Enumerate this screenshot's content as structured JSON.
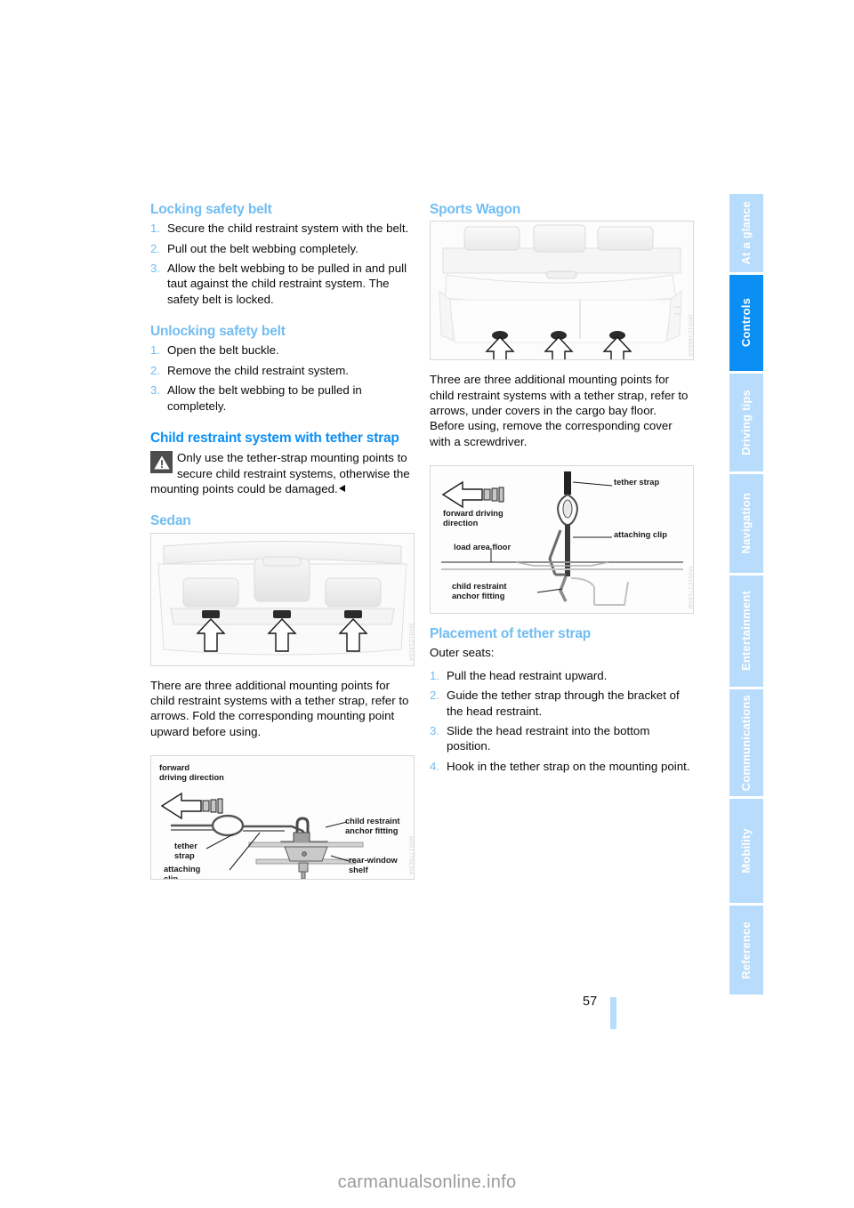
{
  "document": {
    "page_number": "57",
    "watermark": "carmanualsonline.info"
  },
  "nav_rail": {
    "items": [
      {
        "label": "At a glance",
        "active": false
      },
      {
        "label": "Controls",
        "active": true
      },
      {
        "label": "Driving tips",
        "active": false
      },
      {
        "label": "Navigation",
        "active": false
      },
      {
        "label": "Entertainment",
        "active": false
      },
      {
        "label": "Communications",
        "active": false
      },
      {
        "label": "Mobility",
        "active": false
      },
      {
        "label": "Reference",
        "active": false
      }
    ],
    "active_color": "#0c8ff5",
    "inactive_color": "#b8dcfb"
  },
  "left_column": {
    "locking": {
      "heading": "Locking safety belt",
      "steps": [
        {
          "num": "1.",
          "text": "Secure the child restraint system with the belt."
        },
        {
          "num": "2.",
          "text": "Pull out the belt webbing completely."
        },
        {
          "num": "3.",
          "text": "Allow the belt webbing to be pulled in and pull taut against the child restraint system. The safety belt is locked."
        }
      ]
    },
    "unlocking": {
      "heading": "Unlocking safety belt",
      "steps": [
        {
          "num": "1.",
          "text": "Open the belt buckle."
        },
        {
          "num": "2.",
          "text": "Remove the child restraint system."
        },
        {
          "num": "3.",
          "text": "Allow the belt webbing to be pulled in completely."
        }
      ]
    },
    "tether": {
      "heading": "Child restraint system with tether strap",
      "warning_text": "Only use the tether-strap mounting points to secure child restraint systems, otherwise the mounting points could be damaged."
    },
    "sedan": {
      "heading": "Sedan",
      "figure_code": "MV01C1410A",
      "body": "There are three additional mounting points for child restraint systems with a tether strap, refer to arrows. Fold the corresponding mounting point upward before using."
    },
    "sedan_diagram": {
      "figure_code": "MV01779CMA",
      "labels": {
        "forward_direction": "forward\ndriving direction",
        "tether_strap": "tether\nstrap",
        "attaching_clip": "attaching\nclip",
        "anchor_fitting": "child restraint\nanchor fitting",
        "rear_window_shelf": "rear-window\nshelf"
      }
    }
  },
  "right_column": {
    "sports_wagon": {
      "heading": "Sports Wagon",
      "figure_code": "MV01C1680AS",
      "body": "Three are three additional mounting points for child restraint systems with a tether strap, refer to arrows, under covers in the cargo bay floor. Before using, remove the corresponding cover with a screwdriver."
    },
    "wagon_diagram": {
      "figure_code": "MV01C1710AM",
      "labels": {
        "tether_strap": "tether strap",
        "attaching_clip": "attaching clip",
        "forward_direction": "forward driving\ndirection",
        "load_area_floor": "load area floor",
        "anchor_fitting": "child restraint\nanchor fitting"
      }
    },
    "placement": {
      "heading": "Placement of tether strap",
      "intro": "Outer seats:",
      "steps": [
        {
          "num": "1.",
          "text": "Pull the head restraint upward."
        },
        {
          "num": "2.",
          "text": "Guide the tether strap through the bracket of the head restraint."
        },
        {
          "num": "3.",
          "text": "Slide the head restraint into the bottom position."
        },
        {
          "num": "4.",
          "text": "Hook in the tether strap on the mounting point."
        }
      ]
    }
  }
}
